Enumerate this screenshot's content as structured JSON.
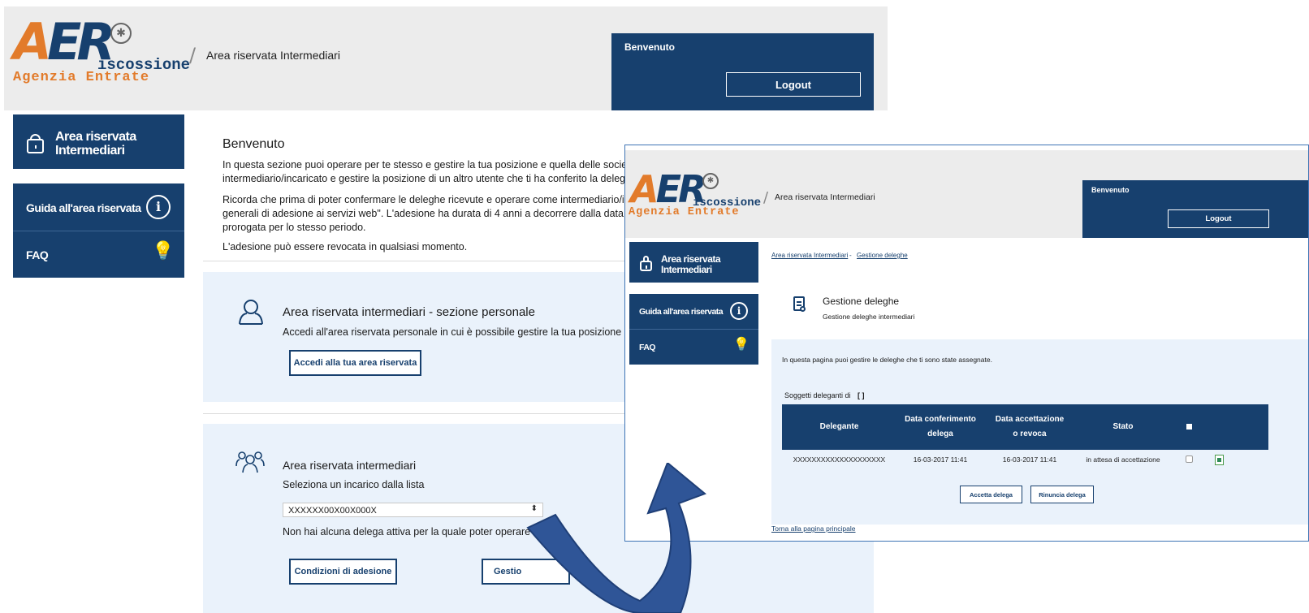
{
  "header": {
    "logo_letters": "AER",
    "logo_word": "iscossione",
    "logo_agency": "Agenzia Entrate",
    "logo_emblem": "emblem-icon",
    "breadcrumb_sep": "/",
    "title": "Area riservata Intermediari",
    "welcome": "Benvenuto",
    "logout": "Logout"
  },
  "sidebar": {
    "area_title": "Area riservata Intermediari",
    "items": [
      {
        "label": "Guida all'area riservata",
        "icon": "info-icon"
      },
      {
        "label": "FAQ",
        "icon": "lightbulb-icon"
      }
    ]
  },
  "main": {
    "title": "Benvenuto",
    "para1_line1": "In questa sezione puoi operare per te stesso e gestire la tua posizione e quella delle società da",
    "para1_line2": "intermediario/incaricato e gestire la posizione di un altro utente che ti ha conferito la delega.",
    "para2_line1": "Ricorda che prima di poter confermare le deleghe ricevute e operare come intermediario/incar",
    "para2_line2": "generali di adesione ai servizi web\". L'adesione ha durata di 4 anni a decorrere dalla data di acc",
    "para2_line3": "prorogata per lo stesso periodo.",
    "para3": "L'adesione può essere revocata in qualsiasi momento.",
    "personal": {
      "title": "Area riservata intermediari - sezione personale",
      "desc": "Accedi all'area riservata personale in cui è possibile gestire la tua posizione e qu",
      "button": "Accedi alla tua area riservata"
    },
    "intermediari": {
      "title": "Area riservata intermediari",
      "desc": "Seleziona un incarico dalla lista",
      "select_value": "XXXXXX00X00X000X",
      "notice": "Non hai alcuna delega attiva per la quale poter operare",
      "btn_conditions": "Condizioni di adesione",
      "btn_manage": "Gestio"
    }
  },
  "overlay": {
    "breadcrumb": [
      "Area riservata Intermediari",
      "-",
      "Gestione deleghe"
    ],
    "page_title": "Gestione deleghe",
    "page_subtitle": "Gestione deleghe intermediari",
    "intro": "In questa pagina puoi gestire le deleghe che ti sono state assegnate.",
    "soggetti_label": "Soggetti deleganti di",
    "soggetti_value": "[ ]",
    "table": {
      "headers": [
        "Delegante",
        "Data conferimento delega",
        "Data accettazione o revoca",
        "Stato"
      ],
      "header_lines": [
        [
          "Delegante"
        ],
        [
          "Data conferimento",
          "delega"
        ],
        [
          "Data accettazione",
          "o revoca"
        ],
        [
          "Stato"
        ]
      ],
      "rows": [
        {
          "delegante": "XXXXXXXXXXXXXXXXXXXX",
          "conferimento": "16-03-2017 11:41",
          "accettazione": "16-03-2017 11:41",
          "stato": "in attesa di accettazione"
        }
      ]
    },
    "btn_accept": "Accetta delega",
    "btn_reject": "Rinuncia delega",
    "back_link": "Torna alla pagina principale"
  },
  "colors": {
    "navy": "#17406e",
    "orange": "#e27b2b",
    "panel": "#eaf2fb",
    "arrow": "#2f5597"
  }
}
